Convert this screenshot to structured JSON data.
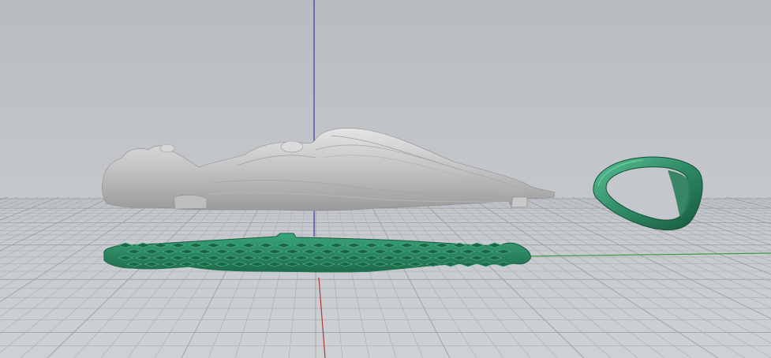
{
  "viewport": {
    "projection": "perspective",
    "background_color": "#c4c7cb",
    "grid_color": "#a8abaf",
    "grid_major_color": "#9da0a4",
    "axis_colors": {
      "x": "#b03a3a",
      "y": "#3f9a4a",
      "z": "#3a3aa6"
    }
  },
  "objects": [
    {
      "name": "relief-sculpture",
      "color": "#c8c8c8"
    },
    {
      "name": "lattice-base",
      "color": "#2e8a66"
    },
    {
      "name": "ring-loop",
      "color": "#2e8a66"
    }
  ]
}
